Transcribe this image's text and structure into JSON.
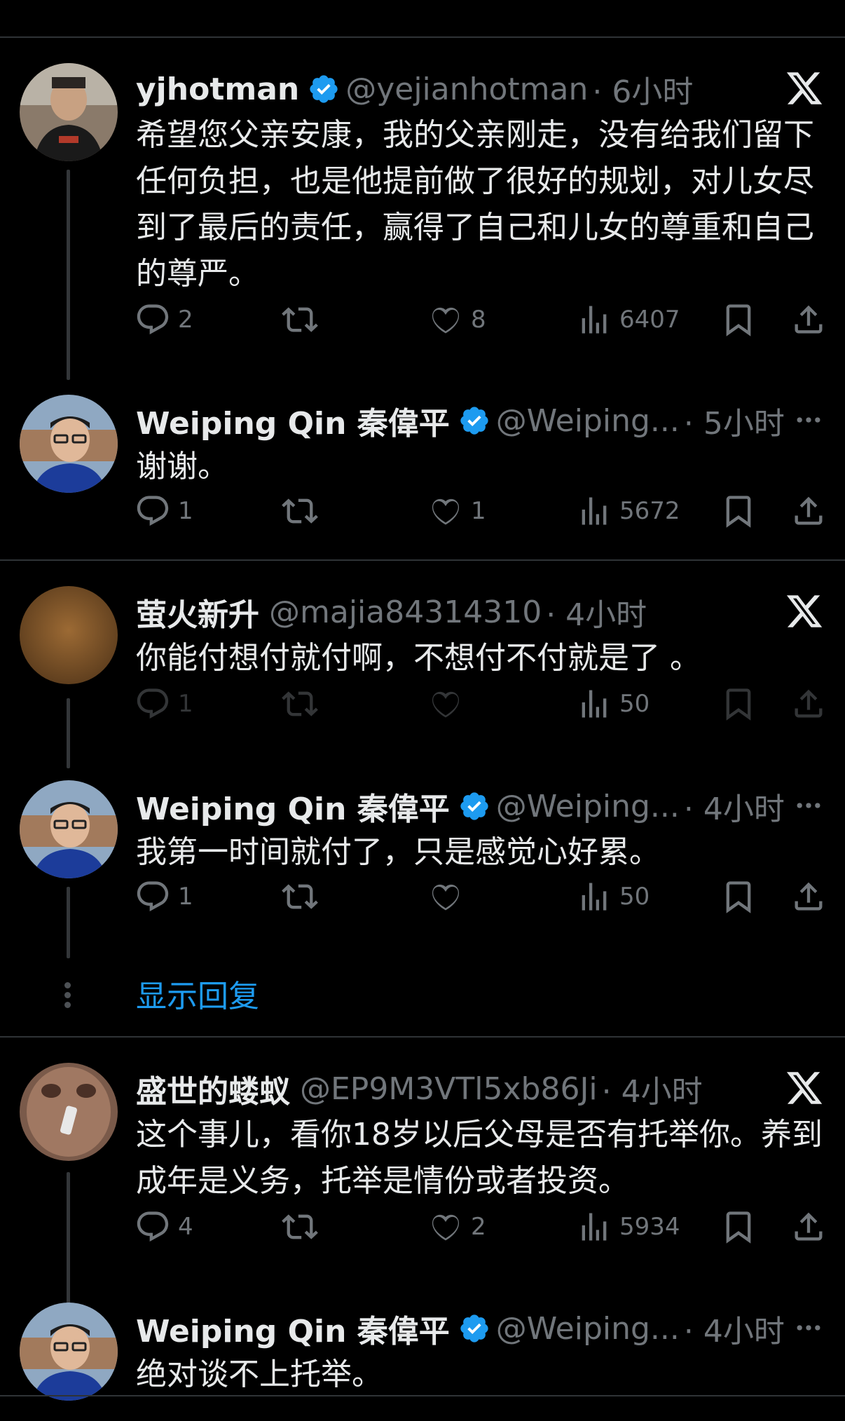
{
  "tweets": [
    {
      "name": "yjhotman",
      "handle": "@yejianhotman",
      "time": "· 6小时",
      "body": "希望您父亲安康，我的父亲刚走，没有给我们留下任何负担，也是他提前做了很好的规划，对儿女尽到了最后的责任，赢得了自己和儿女的尊重和自己的尊严。",
      "replies": "2",
      "retweets": "",
      "likes": "8",
      "views": "6407",
      "corner_icon": "x-logo-icon"
    },
    {
      "name": "Weiping Qin 秦偉平",
      "handle": "@Weiping...",
      "time": "· 5小时",
      "body": "谢谢。",
      "replies": "1",
      "retweets": "",
      "likes": "1",
      "views": "5672",
      "corner_icon": "more-icon"
    },
    {
      "name": "萤火新升",
      "handle": "@majia84314310",
      "time": "· 4小时",
      "body": "你能付想付就付啊，不想付不付就是了 。",
      "replies": "1",
      "retweets": "",
      "likes": "",
      "views": "50",
      "corner_icon": "x-logo-icon"
    },
    {
      "name": "Weiping Qin 秦偉平",
      "handle": "@Weiping...",
      "time": "· 4小时",
      "body": "我第一时间就付了，只是感觉心好累。",
      "replies": "1",
      "retweets": "",
      "likes": "",
      "views": "50",
      "corner_icon": "more-icon"
    },
    {
      "name": "盛世的蝼蚁",
      "handle": "@EP9M3VTl5xb86Ji",
      "time": "· 4小时",
      "body": "这个事儿，看你18岁以后父母是否有托举你。养到成年是义务，托举是情份或者投资。",
      "replies": "4",
      "retweets": "",
      "likes": "2",
      "views": "5934",
      "corner_icon": "x-logo-icon"
    },
    {
      "name": "Weiping Qin 秦偉平",
      "handle": "@Weiping...",
      "time": "· 4小时",
      "body": "绝对谈不上托举。",
      "corner_icon": "more-icon"
    }
  ],
  "show_replies": "显示回复",
  "colors": {
    "accent": "#1d9bf0",
    "text": "#e7e9ea",
    "muted": "#71767b",
    "divider": "#2f3336"
  }
}
